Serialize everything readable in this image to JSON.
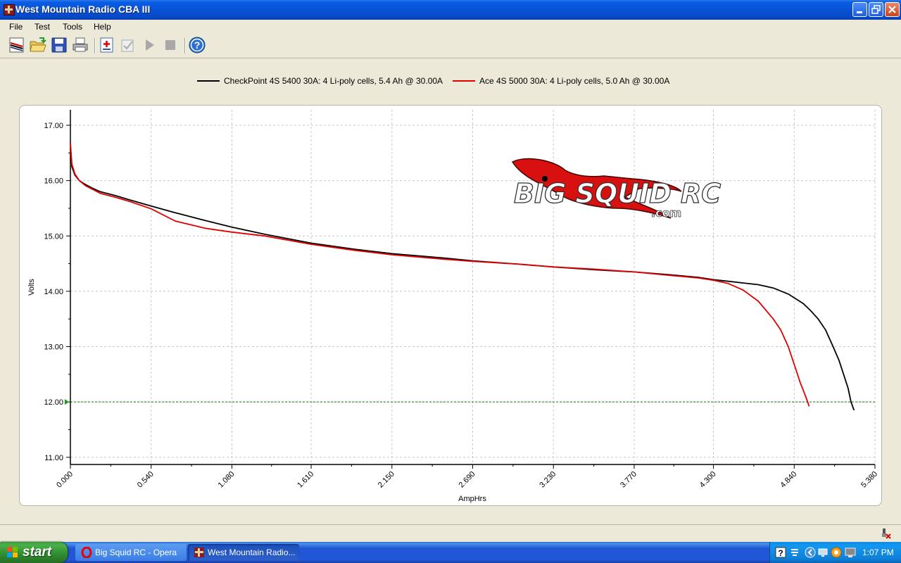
{
  "window": {
    "title": "West Mountain Radio CBA III",
    "controls": [
      "minimize",
      "maximize",
      "close"
    ]
  },
  "menu": {
    "items": [
      "File",
      "Test",
      "Tools",
      "Help"
    ]
  },
  "toolbar": {
    "buttons": [
      "new-test-icon",
      "open-folder-icon",
      "save-icon",
      "print-icon",
      "add-test-icon",
      "checklist-icon",
      "play-icon",
      "stop-icon",
      "help-icon"
    ]
  },
  "legend": {
    "series1": "CheckPoint 4S 5400 30A: 4 Li-poly cells, 5.4 Ah @ 30.00A",
    "series2": "Ace 4S 5000 30A: 4 Li-poly cells, 5.0 Ah @ 30.00A"
  },
  "watermark": {
    "text": "BIG SQUID RC",
    "suffix": ".com"
  },
  "chart_data": {
    "type": "line",
    "xlabel": "AmpHrs",
    "ylabel": "Volts",
    "xlim": [
      0,
      5.38
    ],
    "ylim": [
      10.87,
      17.28
    ],
    "x_ticks": [
      "0.000",
      "0.540",
      "1.080",
      "1.610",
      "2.150",
      "2.690",
      "3.230",
      "3.770",
      "4.300",
      "4.840",
      "5.380"
    ],
    "y_ticks": [
      "17.00",
      "16.00",
      "15.00",
      "14.00",
      "13.00",
      "12.00",
      "11.00"
    ],
    "grid": true,
    "cutoff_voltage": 12.0,
    "series": [
      {
        "name": "CheckPoint 4S 5400 30A: 4 Li-poly cells, 5.4 Ah @ 30.00A",
        "color": "#000000",
        "x": [
          0,
          0.01,
          0.03,
          0.06,
          0.1,
          0.15,
          0.2,
          0.3,
          0.4,
          0.54,
          0.7,
          0.9,
          1.08,
          1.3,
          1.61,
          1.9,
          2.15,
          2.5,
          2.69,
          3.0,
          3.23,
          3.5,
          3.77,
          4.0,
          4.2,
          4.3,
          4.4,
          4.5,
          4.6,
          4.7,
          4.8,
          4.9,
          4.95,
          5.0,
          5.05,
          5.1,
          5.14,
          5.17,
          5.2,
          5.22,
          5.24
        ],
        "y": [
          16.6,
          16.25,
          16.1,
          16.0,
          15.93,
          15.86,
          15.8,
          15.73,
          15.65,
          15.54,
          15.42,
          15.28,
          15.16,
          15.03,
          14.87,
          14.76,
          14.68,
          14.6,
          14.55,
          14.49,
          14.44,
          14.39,
          14.35,
          14.3,
          14.25,
          14.21,
          14.18,
          14.15,
          14.12,
          14.06,
          13.95,
          13.78,
          13.65,
          13.5,
          13.3,
          13.0,
          12.75,
          12.5,
          12.25,
          12.0,
          11.85
        ]
      },
      {
        "name": "Ace 4S 5000 30A: 4 Li-poly cells, 5.0 Ah @ 30.00A",
        "color": "#e00000",
        "x": [
          0,
          0.01,
          0.03,
          0.06,
          0.1,
          0.15,
          0.2,
          0.3,
          0.4,
          0.54,
          0.7,
          0.9,
          1.08,
          1.3,
          1.61,
          1.9,
          2.15,
          2.5,
          2.69,
          3.0,
          3.23,
          3.5,
          3.77,
          4.0,
          4.2,
          4.3,
          4.4,
          4.5,
          4.6,
          4.7,
          4.75,
          4.8,
          4.85,
          4.88,
          4.91,
          4.93,
          4.94
        ],
        "y": [
          16.68,
          16.3,
          16.12,
          16.0,
          15.91,
          15.84,
          15.77,
          15.7,
          15.62,
          15.49,
          15.27,
          15.14,
          15.07,
          15.0,
          14.85,
          14.74,
          14.66,
          14.58,
          14.54,
          14.49,
          14.44,
          14.4,
          14.35,
          14.29,
          14.24,
          14.2,
          14.14,
          14.02,
          13.82,
          13.5,
          13.3,
          13.0,
          12.6,
          12.35,
          12.15,
          12.0,
          11.92
        ]
      }
    ]
  },
  "taskbar": {
    "start_label": "start",
    "tasks": [
      "Big Squid RC - Opera",
      "West Mountain Radio..."
    ],
    "clock": "1:07 PM"
  }
}
